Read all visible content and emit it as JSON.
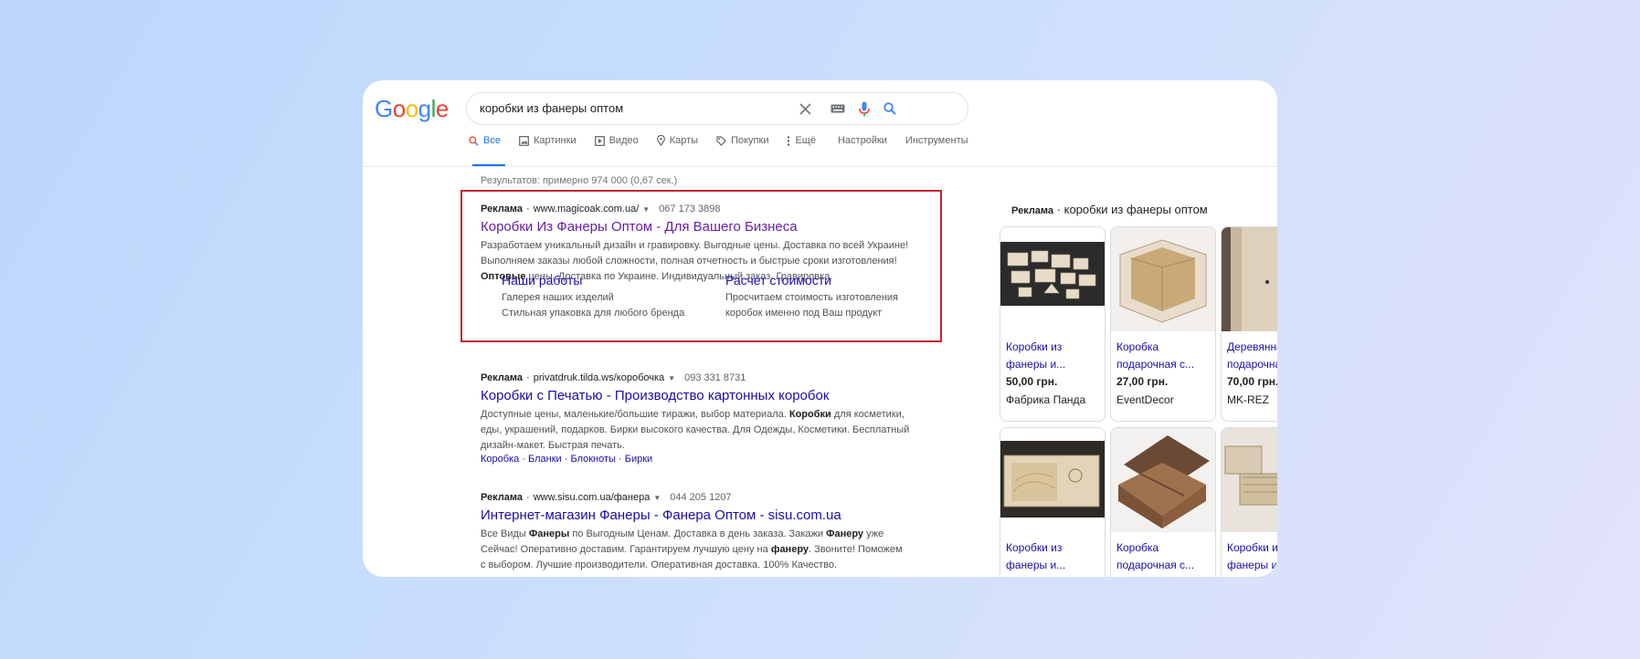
{
  "search": {
    "query": "коробки из фанеры оптом",
    "logo_letters": [
      "G",
      "o",
      "o",
      "g",
      "l",
      "e"
    ]
  },
  "tabs": [
    {
      "label": "Все",
      "icon": "search-icon"
    },
    {
      "label": "Картинки",
      "icon": "image-icon"
    },
    {
      "label": "Видео",
      "icon": "video-icon"
    },
    {
      "label": "Карты",
      "icon": "map-pin-icon"
    },
    {
      "label": "Покупки",
      "icon": "tag-icon"
    },
    {
      "label": "Ещё",
      "icon": "more-vert-icon"
    },
    {
      "label": "Настройки",
      "icon": ""
    },
    {
      "label": "Инструменты",
      "icon": ""
    }
  ],
  "stats": "Результатов: примерно 974 000 (0,67 сек.)",
  "ads": [
    {
      "label": "Реклама",
      "url": "www.magicoak.com.ua/",
      "phone": "067 173 3898",
      "title": "Коробки Из Фанеры Оптом - Для Вашего Бизнеса",
      "desc_line1": "Разработаем уникальный дизайн и гравировку. Выгодные цены. Доставка по всей Украине!",
      "desc_line2": "Выполняем заказы любой сложности, полная отчетность и быстрые сроки изготовления!",
      "desc_line3_bold": "Оптовые",
      "desc_line3_rest": " цены. Доставка по Украине. Индивидуальный заказ. Гравировка.",
      "sitelinks": [
        {
          "title": "Наши работы",
          "line1": "Галерея наших изделий",
          "line2": "Стильная упаковка для любого бренда"
        },
        {
          "title": "Расчет стоимости",
          "line1": "Просчитаем стоимость изготовления",
          "line2": "коробок именно под Ваш продукт"
        }
      ]
    },
    {
      "label": "Реклама",
      "url": "privatdruk.tilda.ws/коробочка",
      "phone": "093 331 8731",
      "title": "Коробки с Печатью - Производство картонных коробок",
      "desc_a": "Доступные цены, маленькие/большие тиражи, выбор материала. ",
      "desc_b_bold": "Коробки",
      "desc_c": " для косметики,",
      "desc_line2": "еды, украшений, подарков. Бирки высокого качества. Для Одежды, Косметики. Бесплатный",
      "desc_line3": "дизайн-макет. Быстрая печать.",
      "links": [
        "Коробка",
        "Бланки",
        "Блокноты",
        "Бирки"
      ],
      "link_sep": " · "
    },
    {
      "label": "Реклама",
      "url": "www.sisu.com.ua/фанера",
      "phone": "044 205 1207",
      "title": "Интернет-магазин Фанеры - Фанера Оптом - sisu.com.ua",
      "l1_a": "Все Виды ",
      "l1_b": "Фанеры",
      "l1_c": " по Выгодным Ценам. Доставка в день заказа. Закажи ",
      "l1_d": "Фанеру",
      "l1_e": " уже",
      "l2_a": "Сейчас! Оперативно доставим. Гарантируем лучшую цену на ",
      "l2_b": "фанеру",
      "l2_c": ". Звоните! Поможем",
      "l3": "с выбором. Лучшие производители. Оперативная доставка. 100% Качество."
    }
  ],
  "shopping": {
    "label": "Реклама",
    "sep": " · ",
    "query": "коробки из фанеры оптом",
    "cards": [
      {
        "title": "Коробки из фанеры и...",
        "price": "50,00 грн.",
        "seller": "Фабрика Панда"
      },
      {
        "title": "Коробка подарочная с...",
        "price": "27,00 грн.",
        "seller": "EventDecor"
      },
      {
        "title": "Деревянная подарочная...",
        "price": "70,00 грн.",
        "seller": "MK-REZ"
      },
      {
        "title": "Коробки из фанеры и...",
        "price": "",
        "seller": ""
      },
      {
        "title": "Коробка подарочная с...",
        "price": "",
        "seller": ""
      },
      {
        "title": "Коробки из фанеры и...",
        "price": "",
        "seller": ""
      }
    ]
  },
  "colors": {
    "link": "#1a0dab",
    "visited": "#681da8",
    "accent": "#1a73e8",
    "highlight_border": "#c3262c"
  }
}
